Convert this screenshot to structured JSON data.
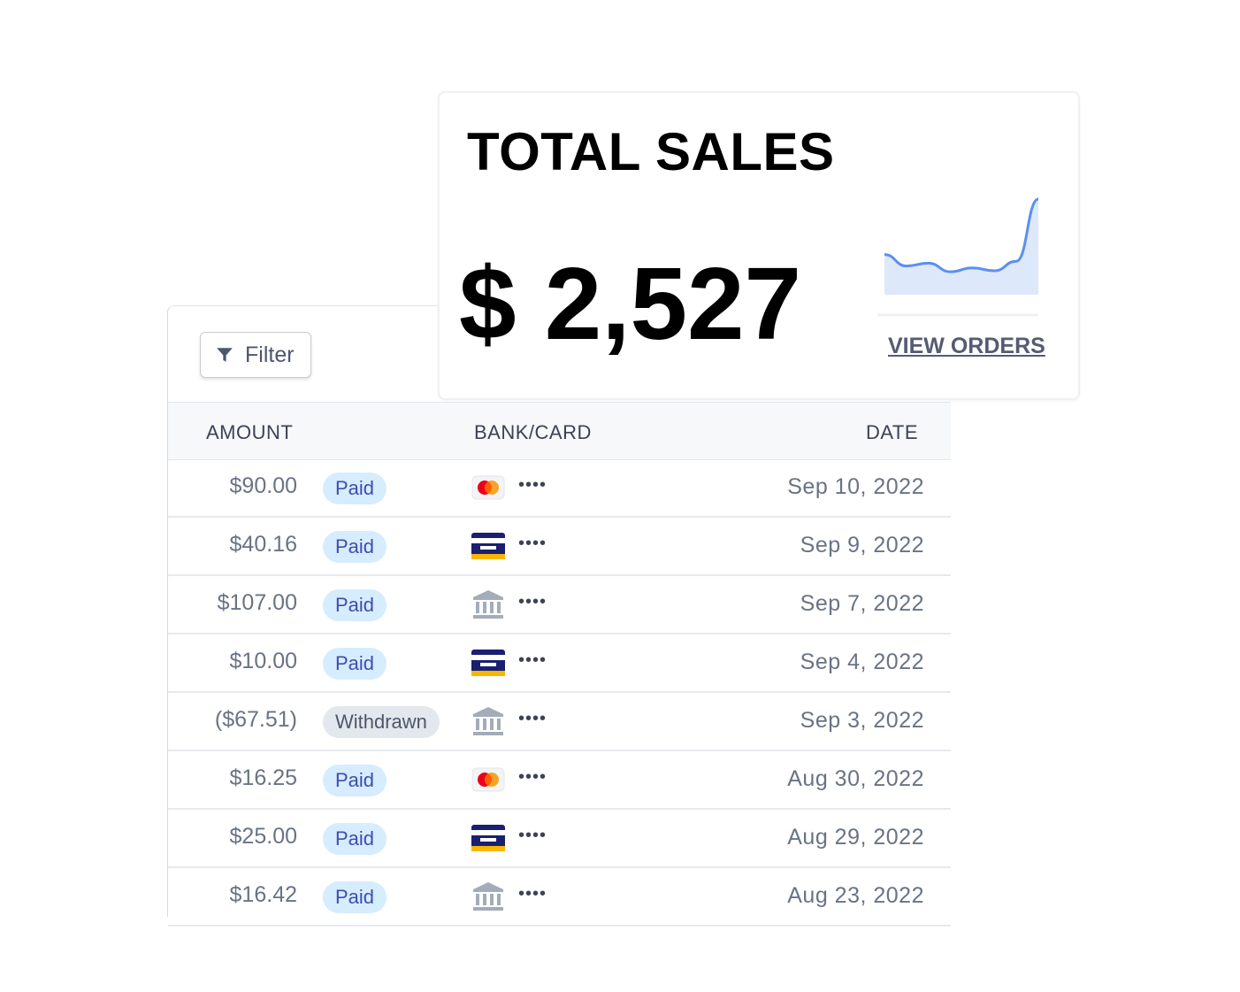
{
  "filter": {
    "label": "Filter",
    "icon": "filter-icon"
  },
  "table": {
    "columns": {
      "amount": "AMOUNT",
      "bank_card": "BANK/CARD",
      "date": "DATE"
    },
    "rows": [
      {
        "amount": "$90.00",
        "status": "Paid",
        "method": "mastercard-icon",
        "mask": "••••",
        "date": "Sep 10, 2022"
      },
      {
        "amount": "$40.16",
        "status": "Paid",
        "method": "card-icon",
        "mask": "••••",
        "date": "Sep 9, 2022"
      },
      {
        "amount": "$107.00",
        "status": "Paid",
        "method": "bank-icon",
        "mask": "••••",
        "date": "Sep 7, 2022"
      },
      {
        "amount": "$10.00",
        "status": "Paid",
        "method": "card-icon",
        "mask": "••••",
        "date": "Sep 4, 2022"
      },
      {
        "amount": "($67.51)",
        "status": "Withdrawn",
        "method": "bank-icon",
        "mask": "••••",
        "date": "Sep 3, 2022"
      },
      {
        "amount": "$16.25",
        "status": "Paid",
        "method": "mastercard-icon",
        "mask": "••••",
        "date": "Aug 30, 2022"
      },
      {
        "amount": "$25.00",
        "status": "Paid",
        "method": "card-icon",
        "mask": "••••",
        "date": "Aug 29, 2022"
      },
      {
        "amount": "$16.42",
        "status": "Paid",
        "method": "bank-icon",
        "mask": "••••",
        "date": "Aug 23, 2022"
      }
    ]
  },
  "sales": {
    "title": "TOTAL SALES",
    "value": "$ 2,527",
    "link": "VIEW ORDERS",
    "sparkline": {
      "values": [
        42,
        30,
        33,
        24,
        28,
        25,
        35,
        100
      ],
      "color": "#5b8ff0",
      "fill": "#dde8fb"
    }
  },
  "colors": {
    "paid_badge": "#d6ecff",
    "withdrawn_badge": "#e3e8ee",
    "accent": "#3d4eac"
  }
}
